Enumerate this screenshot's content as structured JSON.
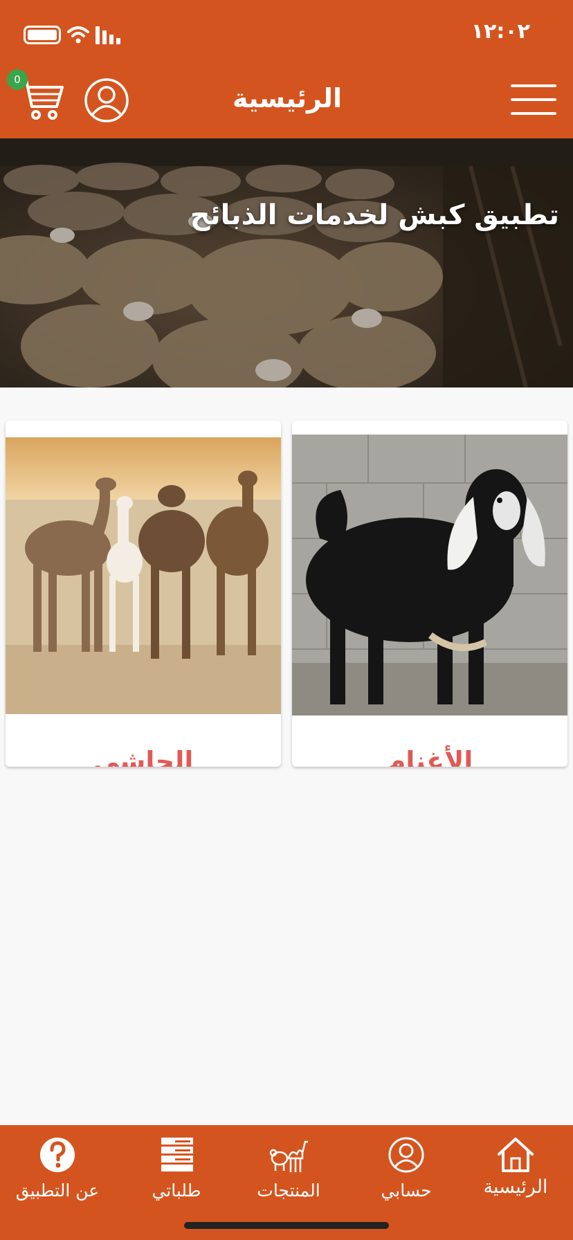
{
  "status_bar": {
    "time": "١٢:٠٢"
  },
  "header": {
    "title": "الرئيسية",
    "cart_count": "0",
    "icons": [
      "cart-icon",
      "profile-icon",
      "menu-icon"
    ]
  },
  "hero": {
    "title": "تطبيق كبش لخدمات الذبائح"
  },
  "categories": [
    {
      "label": "الأغنام",
      "icon": "goat-photo"
    },
    {
      "label": "الحاشي",
      "icon": "camels-photo"
    }
  ],
  "bottom_nav": {
    "items": [
      {
        "label": "الرئيسية",
        "icon": "home-icon"
      },
      {
        "label": "حسابي",
        "icon": "profile-icon"
      },
      {
        "label": "المنتجات",
        "icon": "camel-sheep-icon"
      },
      {
        "label": "طلباتي",
        "icon": "orders-icon"
      },
      {
        "label": "عن التطبيق",
        "icon": "question-icon"
      }
    ]
  },
  "colors": {
    "primary": "#d4541f",
    "category_label": "#e05a55",
    "badge": "#3aa54a",
    "background": "#f8f8f8"
  }
}
